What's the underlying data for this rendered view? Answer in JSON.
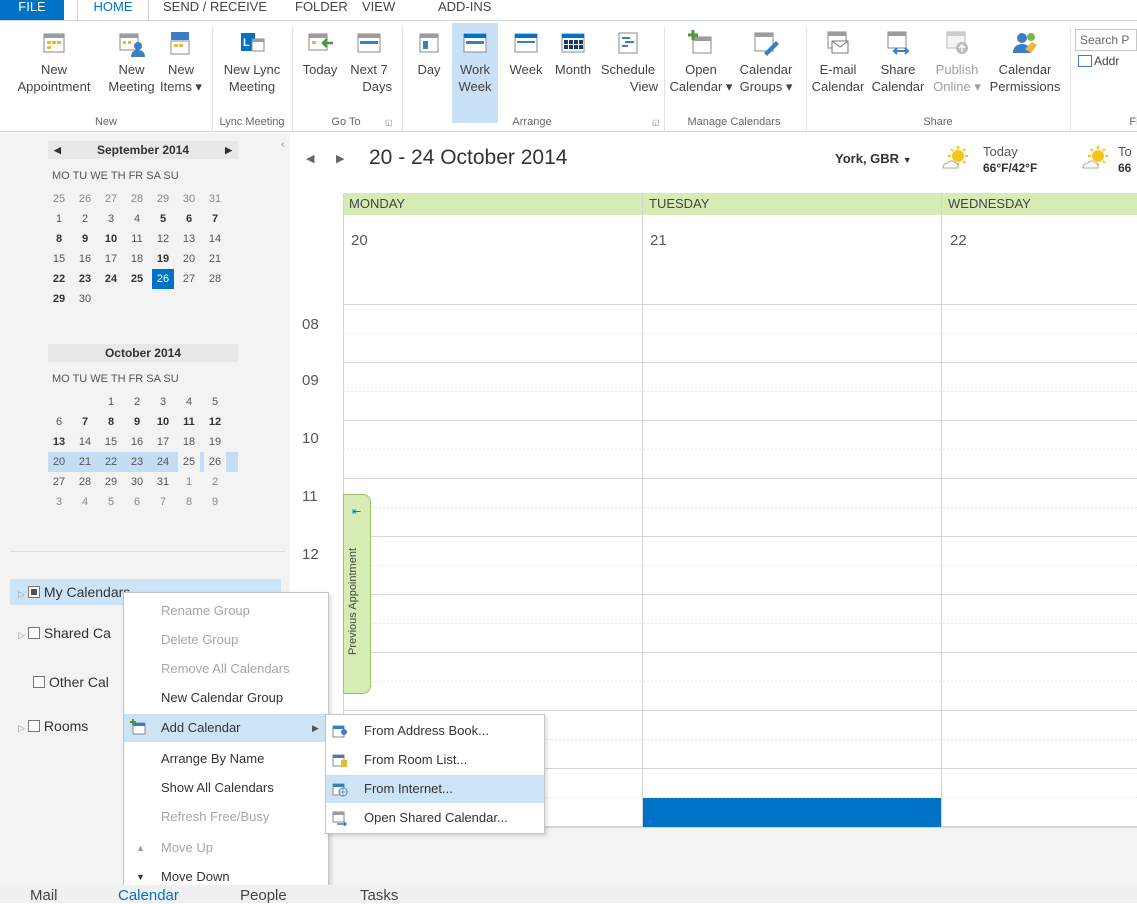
{
  "tabs": [
    "FILE",
    "HOME",
    "SEND / RECEIVE",
    "FOLDER",
    "VIEW",
    "ADD-INS"
  ],
  "ribbon": {
    "new_appointment": [
      "New",
      "Appointment"
    ],
    "new_meeting": [
      "New",
      "Meeting"
    ],
    "new_items": [
      "New",
      "Items ▾"
    ],
    "new_lync_meeting": [
      "New Lync",
      "Meeting"
    ],
    "today": "Today",
    "next7": [
      "Next 7",
      "Days"
    ],
    "day": "Day",
    "work_week": [
      "Work",
      "Week"
    ],
    "week": "Week",
    "month": "Month",
    "schedule_view": [
      "Schedule",
      "View"
    ],
    "open_calendar": [
      "Open",
      "Calendar ▾"
    ],
    "calendar_groups": [
      "Calendar",
      "Groups ▾"
    ],
    "email_calendar": [
      "E-mail",
      "Calendar"
    ],
    "share_calendar": [
      "Share",
      "Calendar"
    ],
    "publish_online": [
      "Publish",
      "Online ▾"
    ],
    "calendar_permissions": [
      "Calendar",
      "Permissions"
    ],
    "search_placeholder": "Search P",
    "address_book": "Addr",
    "groups": {
      "new": "New",
      "lync": "Lync Meeting",
      "goto": "Go To",
      "arrange": "Arrange",
      "manage": "Manage Calendars",
      "share": "Share",
      "find": "Fi"
    }
  },
  "mini_cal": {
    "sep_title": "September 2014",
    "oct_title": "October 2014",
    "dow": "MO TU WE TH FR SA SU",
    "sep_rows": [
      [
        "25",
        "26",
        "27",
        "28",
        "29",
        "30",
        "31"
      ],
      [
        "1",
        "2",
        "3",
        "4",
        "5",
        "6",
        "7"
      ],
      [
        "8",
        "9",
        "10",
        "11",
        "12",
        "13",
        "14"
      ],
      [
        "15",
        "16",
        "17",
        "18",
        "19",
        "20",
        "21"
      ],
      [
        "22",
        "23",
        "24",
        "25",
        "26",
        "27",
        "28"
      ],
      [
        "29",
        "30",
        "",
        "",
        "",
        "",
        ""
      ]
    ],
    "oct_rows": [
      [
        "",
        "",
        "1",
        "2",
        "3",
        "4",
        "5"
      ],
      [
        "6",
        "7",
        "8",
        "9",
        "10",
        "11",
        "12"
      ],
      [
        "13",
        "14",
        "15",
        "16",
        "17",
        "18",
        "19"
      ],
      [
        "20",
        "21",
        "22",
        "23",
        "24",
        "25",
        "26"
      ],
      [
        "27",
        "28",
        "29",
        "30",
        "31",
        "1",
        "2"
      ],
      [
        "3",
        "4",
        "5",
        "6",
        "7",
        "8",
        "9"
      ]
    ]
  },
  "folders": {
    "my": "My Calendars",
    "shared": "Shared Ca",
    "other": "Other Cal",
    "rooms": "Rooms"
  },
  "calendar": {
    "range": "20 - 24 October 2014",
    "location": "York, GBR",
    "weather_today_label": "Today",
    "weather_today_temp": "66°F/42°F",
    "weather_tomorrow_label": "To",
    "weather_tomorrow_temp": "66",
    "days": [
      {
        "name": "MONDAY",
        "num": "20"
      },
      {
        "name": "TUESDAY",
        "num": "21"
      },
      {
        "name": "WEDNESDAY",
        "num": "22"
      }
    ],
    "hours": [
      "08",
      "09",
      "10",
      "11",
      "12"
    ],
    "prev_appointment": "Previous Appointment"
  },
  "context_menu": {
    "items": [
      {
        "label": "Rename Group",
        "disabled": true
      },
      {
        "label": "Delete Group",
        "disabled": true
      },
      {
        "label": "Remove All Calendars",
        "disabled": true
      },
      {
        "label": "New Calendar Group",
        "disabled": false
      },
      {
        "label": "Add Calendar",
        "disabled": false
      },
      {
        "label": "Arrange By Name",
        "disabled": false
      },
      {
        "label": "Show All Calendars",
        "disabled": false
      },
      {
        "label": "Refresh Free/Busy",
        "disabled": true
      },
      {
        "label": "Move Up",
        "disabled": true
      },
      {
        "label": "Move Down",
        "disabled": false
      }
    ],
    "submenu": [
      "From Address Book...",
      "From Room List...",
      "From Internet...",
      "Open Shared Calendar..."
    ]
  },
  "navbar": {
    "mail": "Mail",
    "calendar": "Calendar",
    "people": "People",
    "tasks": "Tasks"
  },
  "colors": {
    "accent": "#0072c6",
    "day_header": "#d7ecb4",
    "selection": "#c9e0f7"
  }
}
